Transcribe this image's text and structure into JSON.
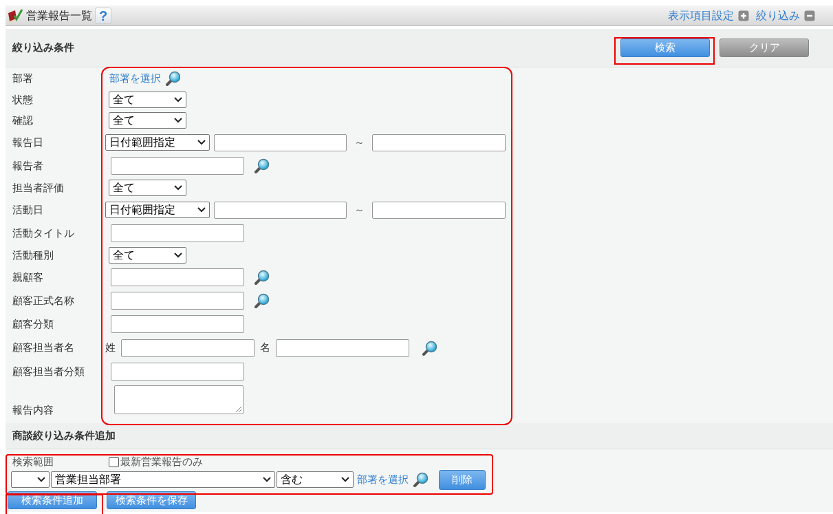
{
  "header": {
    "title": "営業報告一覧",
    "help": "?",
    "links": [
      {
        "label": "表示項目設定",
        "kind": "expand"
      },
      {
        "label": "絞り込み",
        "kind": "collapse"
      }
    ]
  },
  "filter": {
    "title": "絞り込み条件",
    "buttons": [
      {
        "label": "検索",
        "kind": "primary"
      },
      {
        "label": "クリア",
        "kind": "secondary"
      }
    ],
    "rows": [
      {
        "label": "部署",
        "kind": "link",
        "link": "部署を選択"
      },
      {
        "label": "状態",
        "kind": "select",
        "value": "全て"
      },
      {
        "label": "確認",
        "kind": "select",
        "value": "全て"
      },
      {
        "label": "報告日",
        "kind": "date_range",
        "value": "日付範囲指定",
        "separator": "～"
      },
      {
        "label": "報告者",
        "kind": "text_search"
      },
      {
        "label": "担当者評価",
        "kind": "select",
        "value": "全て"
      },
      {
        "label": "活動日",
        "kind": "date_range",
        "value": "日付範囲指定",
        "separator": "～"
      },
      {
        "label": "活動タイトル",
        "kind": "text"
      },
      {
        "label": "活動種別",
        "kind": "select",
        "value": "全て"
      },
      {
        "label": "親顧客",
        "kind": "text_search"
      },
      {
        "label": "顧客正式名称",
        "kind": "text_search"
      },
      {
        "label": "顧客分類",
        "kind": "text"
      },
      {
        "label": "顧客担当者名",
        "kind": "name_pair",
        "first": "姓",
        "last": "名"
      },
      {
        "label": "顧客担当者分類",
        "kind": "text"
      },
      {
        "label": "報告内容",
        "kind": "textarea"
      }
    ]
  },
  "deal_filter": {
    "title": "商談絞り込み条件追加",
    "scope_label": "検索範囲",
    "latest_only": {
      "label": "最新営業報告のみ",
      "checked": false
    },
    "condition": {
      "field": "営業担当部署",
      "operator": "含む",
      "link": "部署を選択",
      "delete": "削除"
    }
  },
  "footer_buttons": [
    "検索条件追加",
    "検索条件を保存"
  ]
}
